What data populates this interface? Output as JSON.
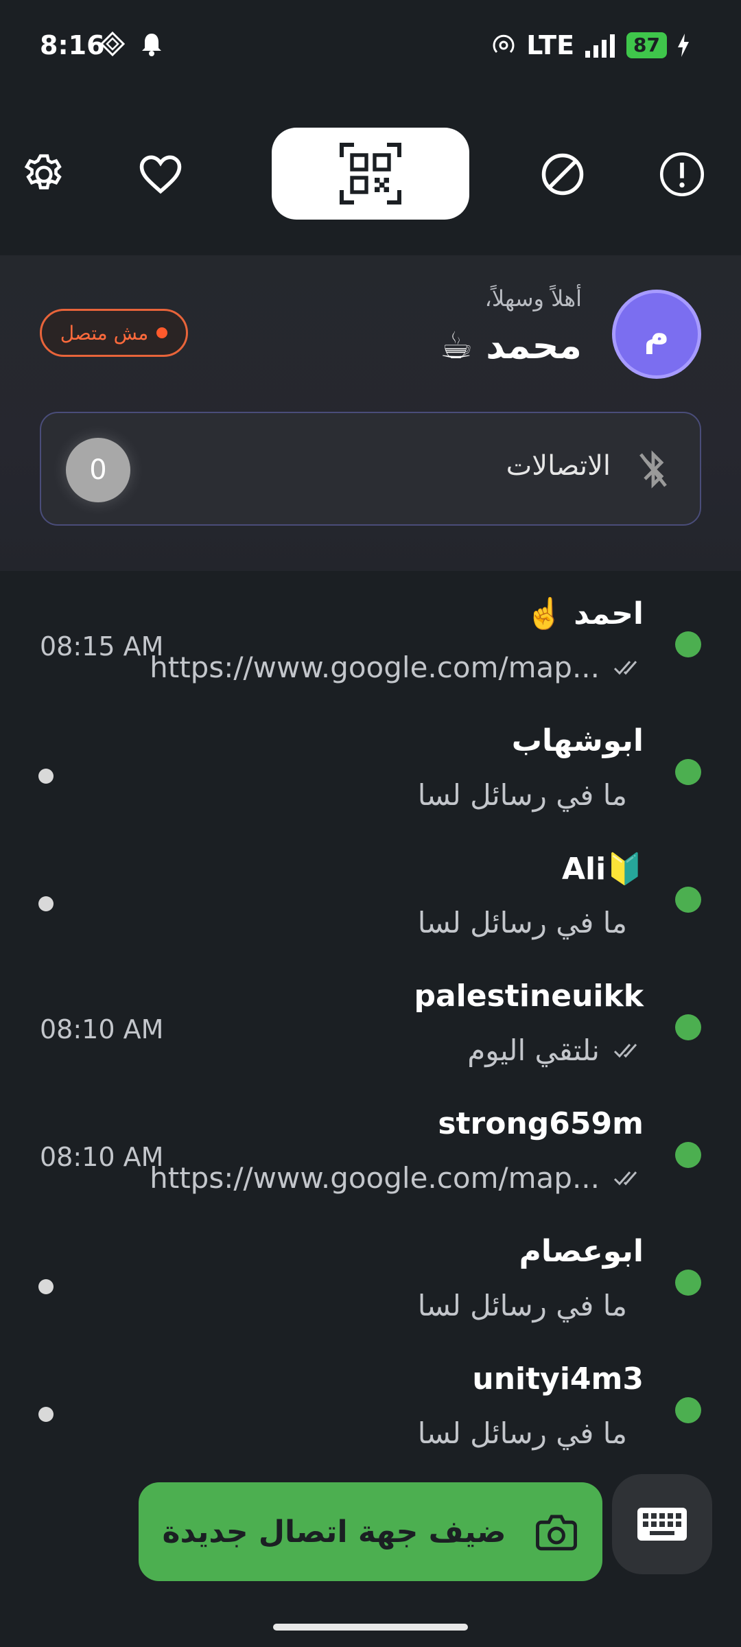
{
  "status_bar": {
    "time": "8:16",
    "network": "LTE",
    "battery": "87"
  },
  "profile": {
    "connection_status": "مش متصل",
    "greeting": "أهلاً وسهلاً،",
    "name": "محمد ☕",
    "avatar_letter": "م",
    "connections_label": "الاتصالات",
    "connections_count": "0"
  },
  "chats": [
    {
      "name": "احمد ☝️",
      "preview": "https://www.google.com/map...",
      "time": "08:15 AM",
      "ticks": true
    },
    {
      "name": "ابوشهاب",
      "preview": "ما في رسائل لسا",
      "time": "",
      "ticks": false
    },
    {
      "name": "Ali🔰",
      "preview": "ما في رسائل لسا",
      "time": "",
      "ticks": false
    },
    {
      "name": "palestineuikk",
      "preview": "نلتقي اليوم",
      "time": "08:10 AM",
      "ticks": true
    },
    {
      "name": "strong659m",
      "preview": "https://www.google.com/map...",
      "time": "08:10 AM",
      "ticks": true
    },
    {
      "name": "ابوعصام",
      "preview": "ما في رسائل لسا",
      "time": "",
      "ticks": false
    },
    {
      "name": "unityi4m3",
      "preview": "ما في رسائل لسا",
      "time": "",
      "ticks": false
    }
  ],
  "actions": {
    "add_contact_label": "ضيف جهة اتصال جديدة"
  },
  "colors": {
    "background": "#1b1f23",
    "accent_green": "#4caf50",
    "offline_orange": "#ff5a2c",
    "avatar_purple": "#7b6ef0"
  }
}
